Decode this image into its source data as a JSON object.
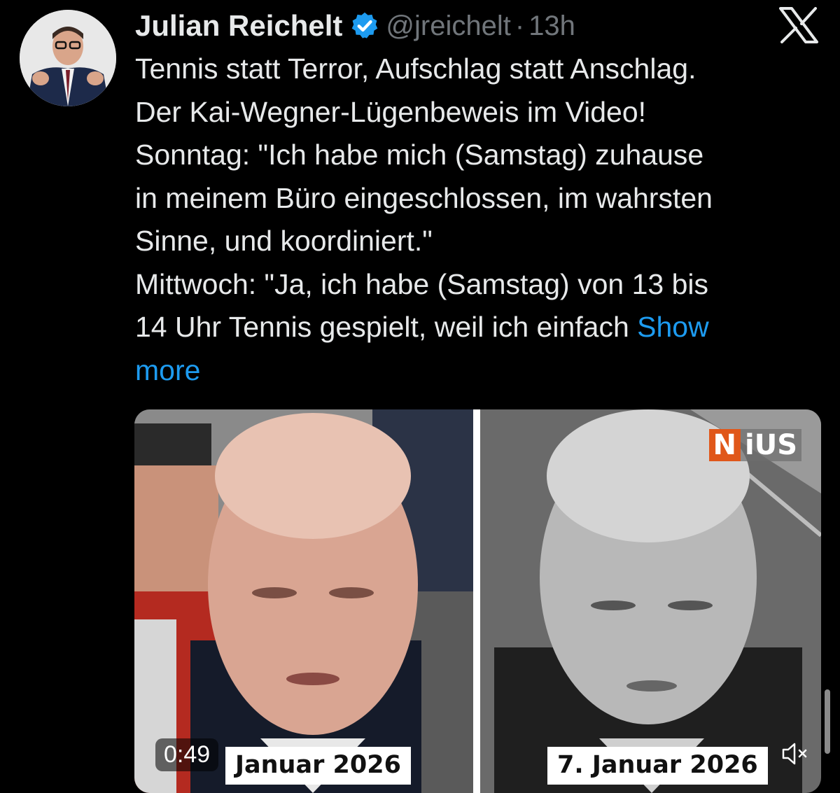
{
  "author": {
    "name": "Julian Reichelt",
    "handle": "@jreichelt",
    "separator": "·",
    "time": "13h",
    "verified": true,
    "avatar_icon": "profile-photo"
  },
  "platform_icon": "x-logo-icon",
  "tweet": {
    "lines": [
      "Tennis statt Terror, Aufschlag statt Anschlag.",
      "Der Kai-Wegner-Lügenbeweis im Video!",
      "Sonntag: \"Ich habe mich (Samstag) zuhause",
      "in meinem Büro eingeschlossen, im wahrsten",
      "Sinne, und koordiniert.\"",
      "Mittwoch: \"Ja, ich habe (Samstag) von 13 bis",
      "14 Uhr Tennis gespielt, weil ich einfach"
    ],
    "show_more_part1": "Show",
    "show_more_part2": "more"
  },
  "media": {
    "duration": "0:49",
    "left_caption": "Januar 2026",
    "right_caption": "7. Januar 2026",
    "watermark_n": "N",
    "watermark_rest": "iUS",
    "mute_icon": "volume-muted-icon"
  },
  "colors": {
    "background": "#000000",
    "text": "#e7e9ea",
    "secondary": "#71767b",
    "link": "#1d9bf0",
    "verified": "#1d9bf0",
    "nius_accent": "#e0571a"
  }
}
